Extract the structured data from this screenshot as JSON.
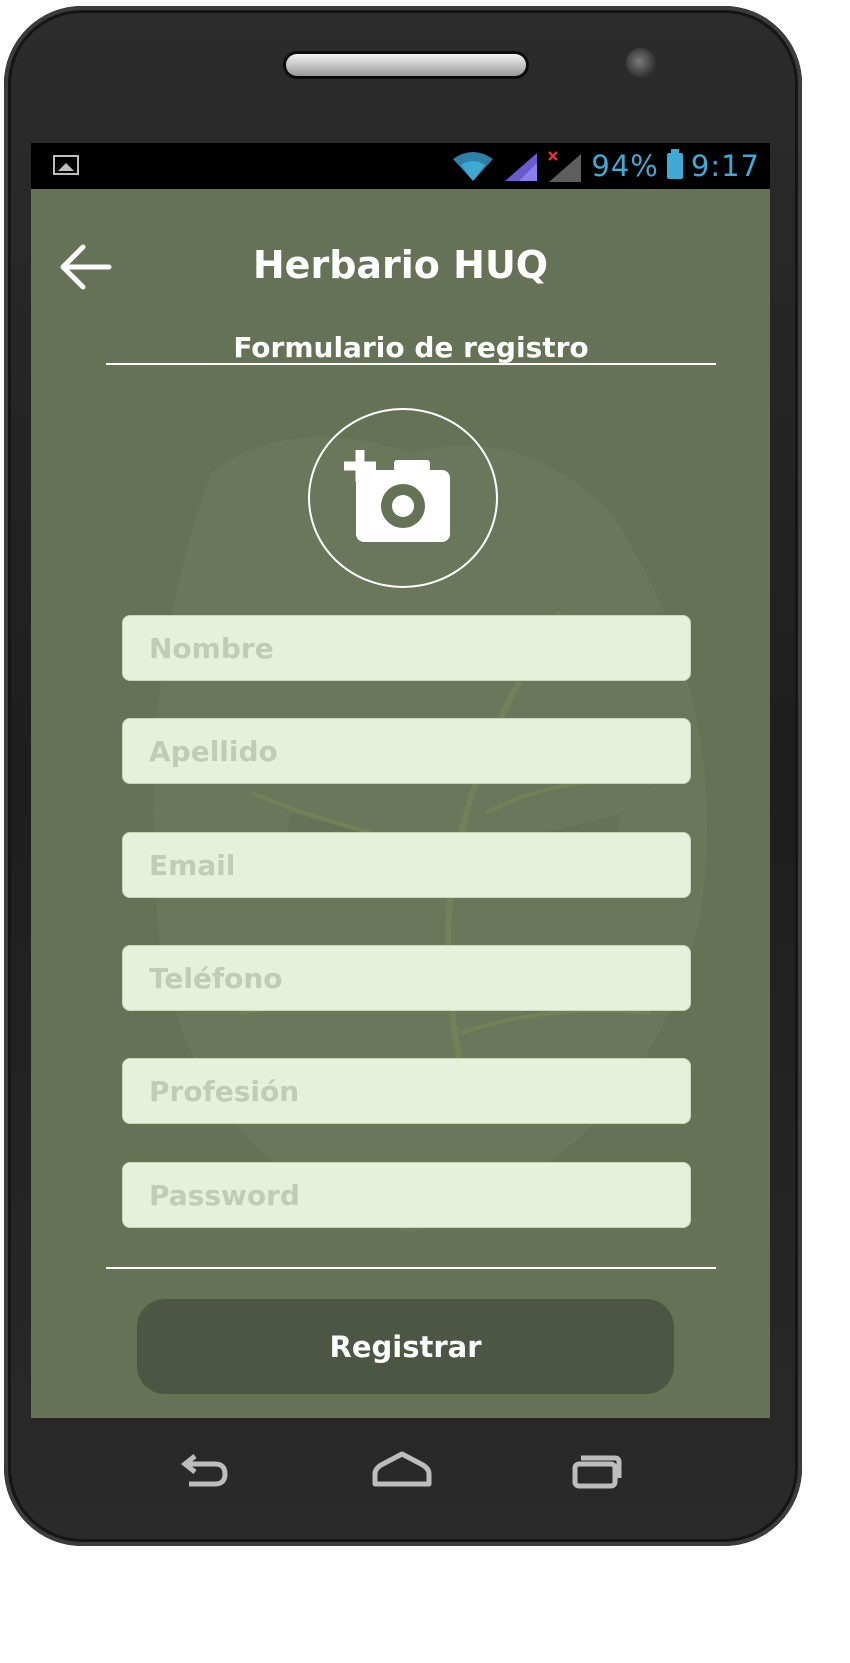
{
  "status_bar": {
    "battery": "94%",
    "time": "9:17",
    "icons": [
      "gallery-icon",
      "wifi-icon",
      "signal-icon",
      "no-signal-icon",
      "battery-icon"
    ]
  },
  "app_bar": {
    "title": "Herbario HUQ",
    "back_icon": "arrow-left-icon"
  },
  "form": {
    "heading": "Formulario de registro",
    "photo_icon": "add-photo-icon",
    "fields": [
      {
        "name": "nombre",
        "placeholder": "Nombre",
        "value": ""
      },
      {
        "name": "apellido",
        "placeholder": "Apellido",
        "value": ""
      },
      {
        "name": "email",
        "placeholder": "Email",
        "value": ""
      },
      {
        "name": "telefono",
        "placeholder": "Teléfono",
        "value": ""
      },
      {
        "name": "profesion",
        "placeholder": "Profesión",
        "value": ""
      },
      {
        "name": "password",
        "placeholder": "Password",
        "value": ""
      }
    ],
    "submit_label": "Registrar"
  },
  "nav_bar": {
    "icons": [
      "back-nav-icon",
      "home-nav-icon",
      "recents-nav-icon"
    ]
  },
  "colors": {
    "background": "#657255",
    "field": "#e6f1dc",
    "button": "#4c5642",
    "status_accent": "#3fa9d6"
  }
}
